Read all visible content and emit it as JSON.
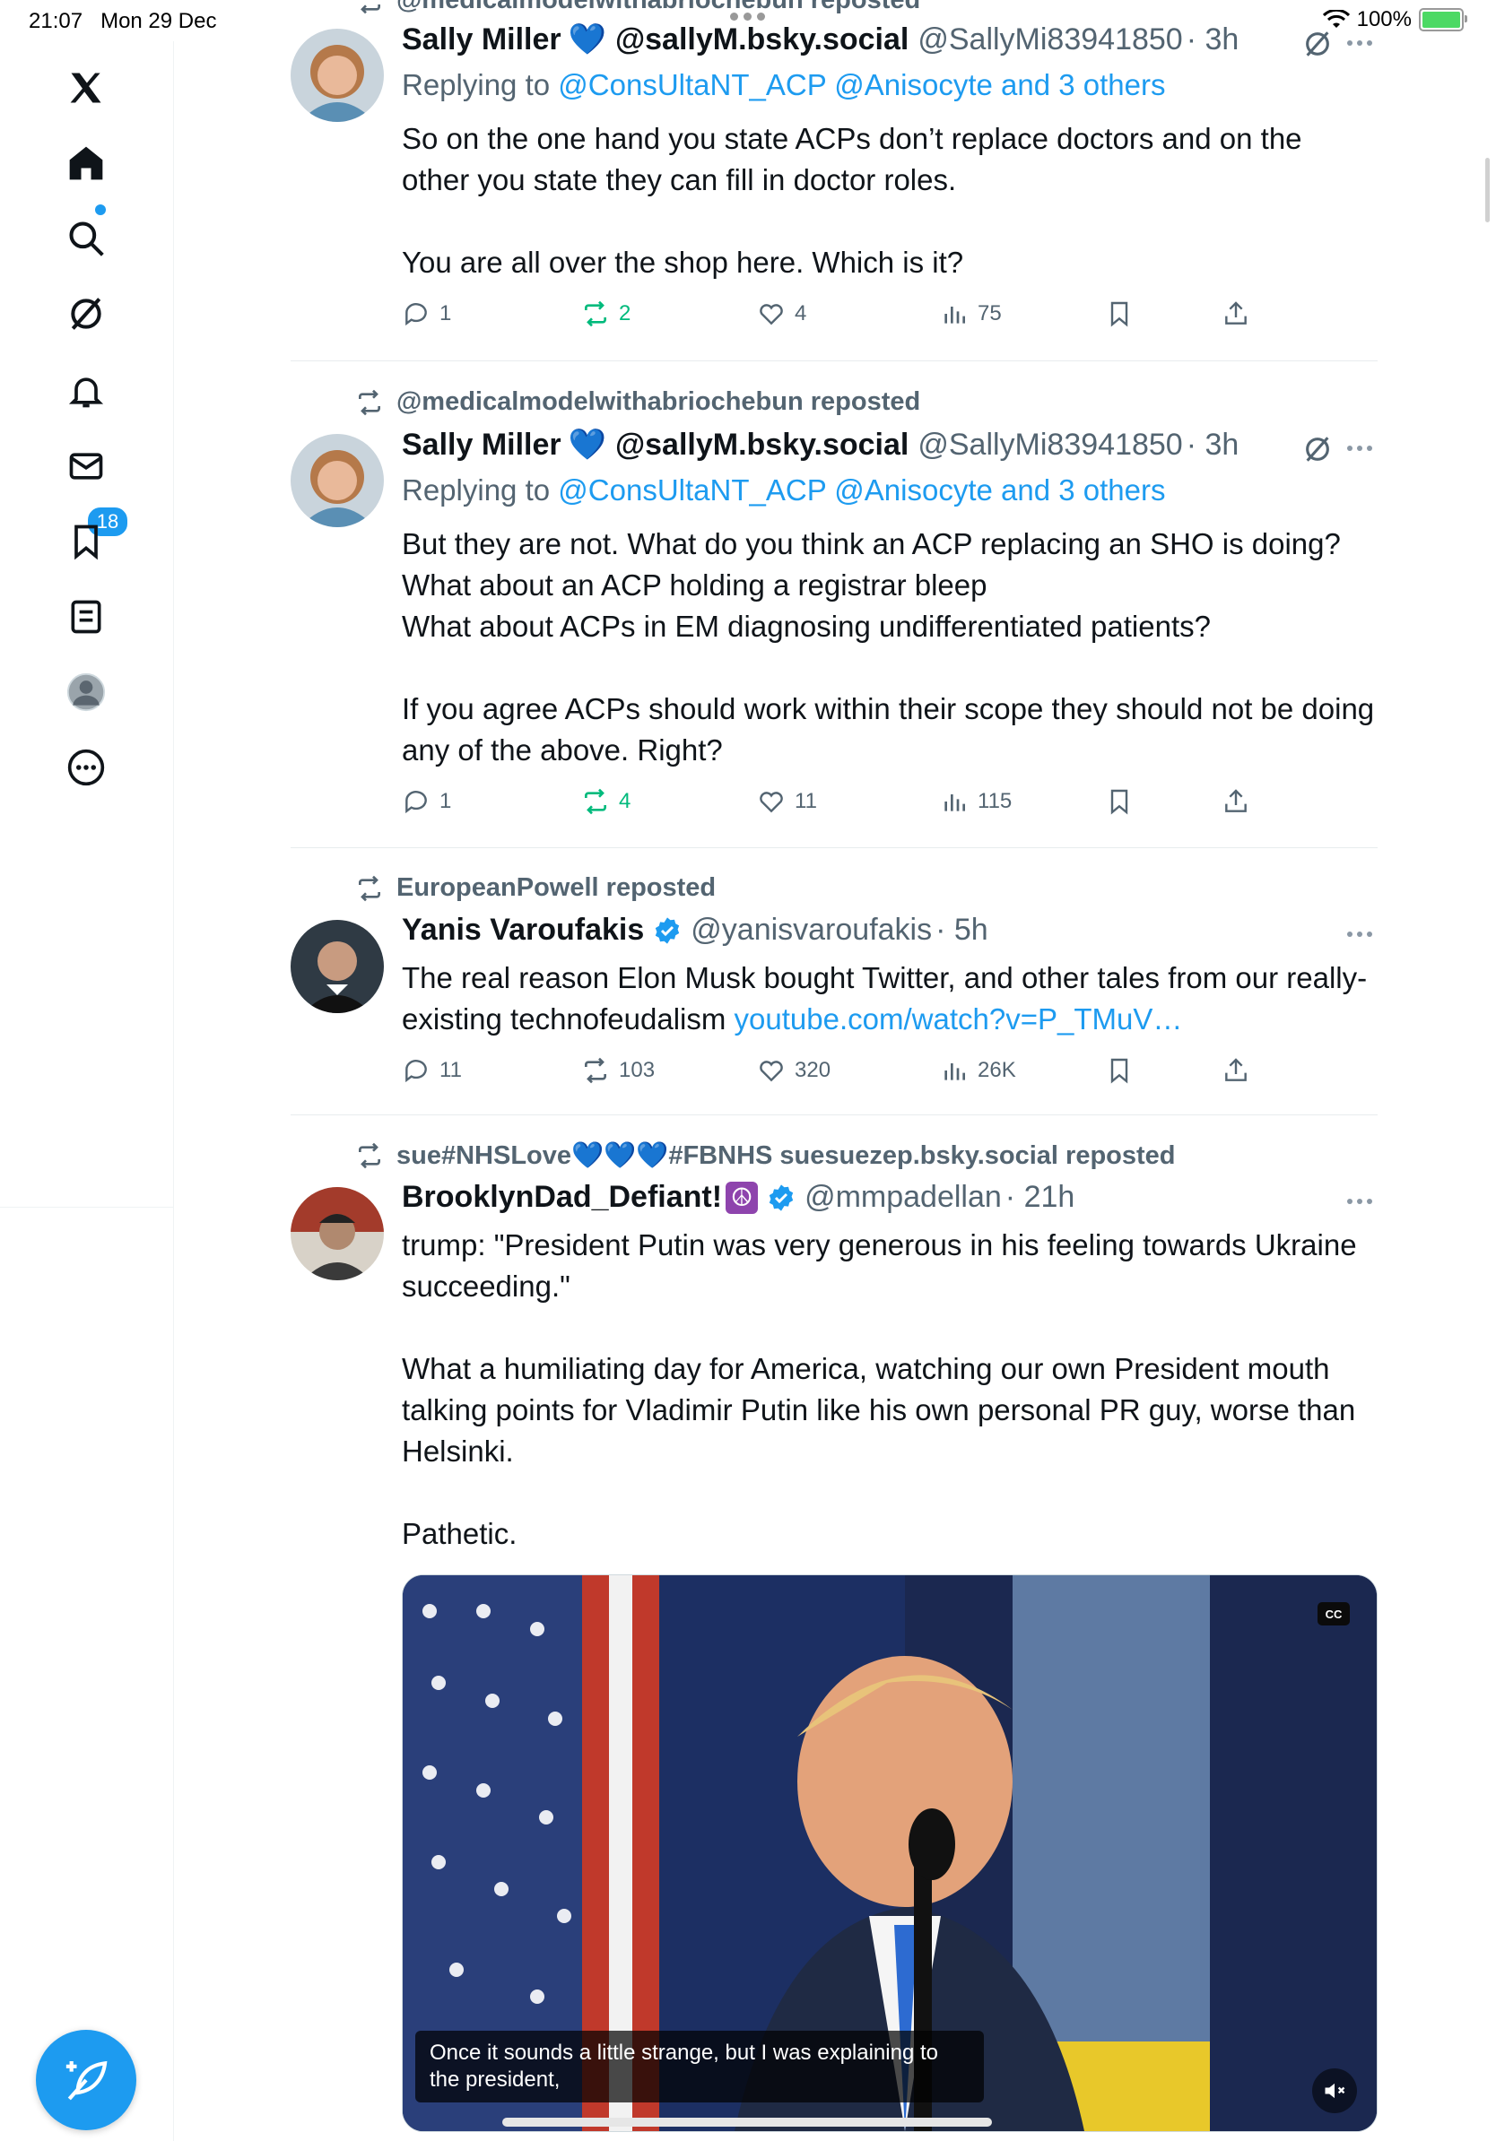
{
  "status_bar": {
    "time": "21:07",
    "date": "Mon 29 Dec",
    "battery": "100%"
  },
  "sidebar": {
    "items": [
      {
        "name": "x-logo"
      },
      {
        "name": "home"
      },
      {
        "name": "search"
      },
      {
        "name": "grok"
      },
      {
        "name": "notifications",
        "badge": "18"
      },
      {
        "name": "messages"
      },
      {
        "name": "bookmarks"
      },
      {
        "name": "lists"
      },
      {
        "name": "profile"
      },
      {
        "name": "more"
      }
    ]
  },
  "tweets": [
    {
      "reposted_by": "@medicalmodelwithabriochebun reposted",
      "name": "Sally Miller",
      "handle": "@sallyM.bsky.social",
      "screen_name": "@SallyMi83941850",
      "time": "· 3h",
      "replying_prefix": "Replying to",
      "replying_to": "@ConsUltaNT_ACP @Anisocyte and 3 others",
      "text": "So on the one hand you state ACPs don’t replace doctors and on the other you state they can fill in doctor roles.\n\nYou are all over the shop here. Which is it?",
      "replies": "1",
      "reposts": "2",
      "likes": "4",
      "views": "75"
    },
    {
      "reposted_by": "@medicalmodelwithabriochebun reposted",
      "name": "Sally Miller",
      "handle": "@sallyM.bsky.social",
      "screen_name": "@SallyMi83941850",
      "time": "· 3h",
      "replying_prefix": "Replying to",
      "replying_to": "@ConsUltaNT_ACP @Anisocyte and 3 others",
      "text": "But they are not. What do you think an ACP replacing an SHO is doing?\nWhat about an ACP holding a registrar bleep\nWhat about ACPs in EM diagnosing undifferentiated patients?\n\nIf you agree ACPs should work within their scope they should not be doing any of the above. Right?",
      "replies": "1",
      "reposts": "4",
      "likes": "11",
      "views": "115"
    },
    {
      "reposted_by": "EuropeanPowell reposted",
      "name": "Yanis Varoufakis",
      "screen_name": "@yanisvaroufakis",
      "time": "· 5h",
      "text": "The real reason Elon Musk bought Twitter, and other tales from our really-existing technofeudalism ",
      "link": "youtube.com/watch?v=P_TMuV…",
      "replies": "11",
      "reposts": "103",
      "likes": "320",
      "views": "26K"
    },
    {
      "reposted_by": "sue#NHSLove💙💙💙#FBNHS suesuezep.bsky.social reposted",
      "name": "BrooklynDad_Defiant!",
      "name_emoji": "☮",
      "screen_name": "@mmpadellan",
      "time": "· 21h",
      "text": "trump: \"President Putin was very generous in his feeling towards Ukraine succeeding.\"\n\nWhat a humiliating day for America, watching our own President mouth talking points for Vladimir Putin like his own personal PR guy, worse than Helsinki.\n\nPathetic.",
      "video_caption": "Once it sounds a little strange, but I was explaining to the president,",
      "video_cc": "CC"
    }
  ],
  "colors": {
    "accent": "#1d9bf0",
    "repost_active": "#00ba7c",
    "secondary_text": "#536471"
  }
}
